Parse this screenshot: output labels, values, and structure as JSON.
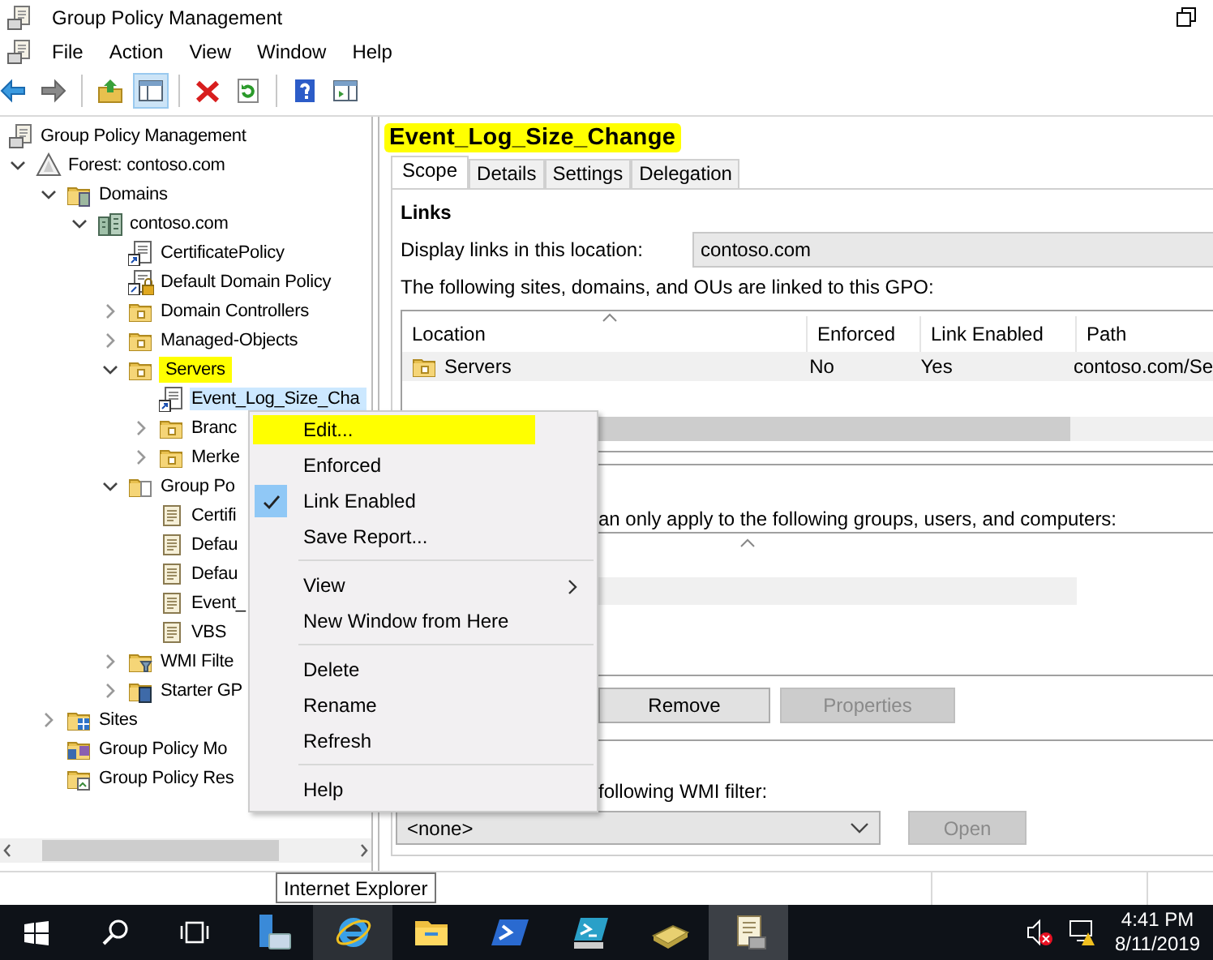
{
  "window": {
    "title": "Group Policy Management"
  },
  "menu_bar": [
    "File",
    "Action",
    "View",
    "Window",
    "Help"
  ],
  "toolbar": [
    {
      "kind": "back",
      "pressed": false
    },
    {
      "kind": "forward",
      "pressed": false
    },
    {
      "kind": "separator"
    },
    {
      "kind": "up",
      "pressed": false
    },
    {
      "kind": "pane",
      "pressed": true
    },
    {
      "kind": "separator"
    },
    {
      "kind": "delete",
      "pressed": false
    },
    {
      "kind": "refresh",
      "pressed": false
    },
    {
      "kind": "separator"
    },
    {
      "kind": "help",
      "pressed": false
    },
    {
      "kind": "action-pane",
      "pressed": false
    }
  ],
  "tree": {
    "label": "Group Policy Management",
    "kind": "console",
    "selected": false,
    "highlighted": false,
    "children": [
      {
        "label": "Forest: contoso.com",
        "kind": "forest",
        "expanded": true,
        "selected": false,
        "highlighted": false,
        "children": [
          {
            "label": "Domains",
            "kind": "domains",
            "expanded": true,
            "selected": false,
            "highlighted": false,
            "children": [
              {
                "label": "contoso.com",
                "kind": "domain",
                "expanded": true,
                "selected": false,
                "highlighted": false,
                "children": [
                  {
                    "label": "CertificatePolicy",
                    "kind": "gpo-link",
                    "selected": false,
                    "highlighted": false
                  },
                  {
                    "label": "Default Domain Policy",
                    "kind": "gpo-link-locked",
                    "selected": false,
                    "highlighted": false
                  },
                  {
                    "label": "Domain Controllers",
                    "kind": "ou",
                    "expanded": false,
                    "selected": false,
                    "highlighted": false
                  },
                  {
                    "label": "Managed-Objects",
                    "kind": "ou",
                    "expanded": false,
                    "selected": false,
                    "highlighted": false
                  },
                  {
                    "label": "Servers",
                    "kind": "ou",
                    "expanded": true,
                    "selected": false,
                    "highlighted": true,
                    "children": [
                      {
                        "label": "Event_Log_Size_Cha",
                        "kind": "gpo-link",
                        "selected": true,
                        "highlighted": false
                      },
                      {
                        "label": "Branc",
                        "kind": "ou",
                        "expanded": false,
                        "selected": false,
                        "highlighted": false
                      },
                      {
                        "label": "Merke",
                        "kind": "ou",
                        "expanded": false,
                        "selected": false,
                        "highlighted": false
                      }
                    ]
                  },
                  {
                    "label": "Group Po",
                    "kind": "gpo-folder",
                    "expanded": true,
                    "selected": false,
                    "highlighted": false,
                    "children": [
                      {
                        "label": "Certifi",
                        "kind": "gpo",
                        "selected": false,
                        "highlighted": false
                      },
                      {
                        "label": "Defau",
                        "kind": "gpo",
                        "selected": false,
                        "highlighted": false
                      },
                      {
                        "label": "Defau",
                        "kind": "gpo",
                        "selected": false,
                        "highlighted": false
                      },
                      {
                        "label": "Event_",
                        "kind": "gpo",
                        "selected": false,
                        "highlighted": false
                      },
                      {
                        "label": "VBS",
                        "kind": "gpo",
                        "selected": false,
                        "highlighted": false
                      }
                    ]
                  },
                  {
                    "label": "WMI Filte",
                    "kind": "wmi",
                    "expanded": false,
                    "selected": false,
                    "highlighted": false
                  },
                  {
                    "label": "Starter GP",
                    "kind": "starter",
                    "expanded": false,
                    "selected": false,
                    "highlighted": false
                  }
                ]
              }
            ]
          },
          {
            "label": "Sites",
            "kind": "sites",
            "expanded": false,
            "selected": false,
            "highlighted": false
          },
          {
            "label": "Group Policy Mo",
            "kind": "modeling",
            "selected": false,
            "highlighted": false
          },
          {
            "label": "Group Policy Res",
            "kind": "results",
            "selected": false,
            "highlighted": false
          }
        ]
      }
    ]
  },
  "details": {
    "title": "Event_Log_Size_Change",
    "title_highlighted": true,
    "tabs": [
      {
        "label": "Scope",
        "selected": true
      },
      {
        "label": "Details",
        "selected": false
      },
      {
        "label": "Settings",
        "selected": false
      },
      {
        "label": "Delegation",
        "selected": false
      }
    ],
    "links": {
      "heading": "Links",
      "location_label": "Display links in this location:",
      "location_value": "contoso.com",
      "caption": "The following sites, domains, and OUs are linked to this GPO:",
      "columns": [
        "Location",
        "Enforced",
        "Link Enabled",
        "Path"
      ],
      "rows": [
        {
          "location": "Servers",
          "enforced": "No",
          "link_enabled": "Yes",
          "path": "contoso.com/Se"
        }
      ]
    },
    "security_filtering": {
      "text": "an only apply to the following groups, users, and computers:",
      "buttons": [
        {
          "label": "Remove",
          "disabled": false
        },
        {
          "label": "Properties",
          "disabled": true
        }
      ]
    },
    "wmi_filtering": {
      "text": "following WMI filter:",
      "value": "<none>",
      "button": {
        "label": "Open",
        "disabled": true
      }
    }
  },
  "context_menu": [
    {
      "kind": "item",
      "label": "Edit...",
      "checked": false,
      "submenu": false,
      "highlighted": true
    },
    {
      "kind": "item",
      "label": "Enforced",
      "checked": false,
      "submenu": false,
      "highlighted": false
    },
    {
      "kind": "item",
      "label": "Link Enabled",
      "checked": true,
      "submenu": false,
      "highlighted": false
    },
    {
      "kind": "item",
      "label": "Save Report...",
      "checked": false,
      "submenu": false,
      "highlighted": false
    },
    {
      "kind": "separator"
    },
    {
      "kind": "item",
      "label": "View",
      "checked": false,
      "submenu": true,
      "highlighted": false
    },
    {
      "kind": "item",
      "label": "New Window from Here",
      "checked": false,
      "submenu": false,
      "highlighted": false
    },
    {
      "kind": "separator"
    },
    {
      "kind": "item",
      "label": "Delete",
      "checked": false,
      "submenu": false,
      "highlighted": false
    },
    {
      "kind": "item",
      "label": "Rename",
      "checked": false,
      "submenu": false,
      "highlighted": false
    },
    {
      "kind": "item",
      "label": "Refresh",
      "checked": false,
      "submenu": false,
      "highlighted": false
    },
    {
      "kind": "separator"
    },
    {
      "kind": "item",
      "label": "Help",
      "checked": false,
      "submenu": false,
      "highlighted": false
    }
  ],
  "tooltip": "Internet Explorer",
  "taskbar": {
    "items": [
      {
        "kind": "start",
        "hovered": false,
        "active": false
      },
      {
        "kind": "search",
        "hovered": false,
        "active": false
      },
      {
        "kind": "task-view",
        "hovered": false,
        "active": false
      },
      {
        "kind": "server-manager",
        "hovered": false,
        "active": false
      },
      {
        "kind": "ie",
        "hovered": true,
        "active": false
      },
      {
        "kind": "explorer",
        "hovered": false,
        "active": false
      },
      {
        "kind": "powershell",
        "hovered": false,
        "active": false
      },
      {
        "kind": "powershell-ise",
        "hovered": false,
        "active": false
      },
      {
        "kind": "book",
        "hovered": false,
        "active": false
      },
      {
        "kind": "gpm",
        "hovered": false,
        "active": true
      }
    ],
    "tray": [
      {
        "kind": "volume-muted"
      },
      {
        "kind": "network-warning"
      }
    ],
    "time": "4:41 PM",
    "date": "8/11/2019"
  }
}
